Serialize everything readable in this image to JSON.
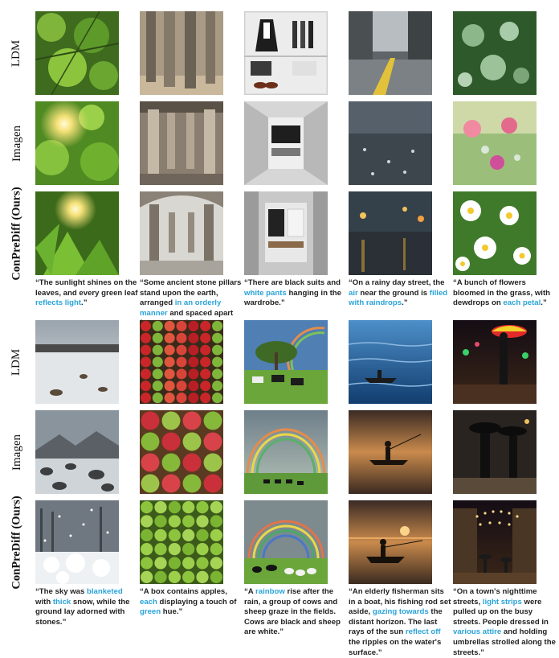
{
  "panels": [
    {
      "row_labels": [
        "LDM",
        "Imagen",
        "ConPreDiff (Ours)"
      ],
      "captions": [
        [
          {
            "t": "“The sunlight shines on the leaves, and every green leaf "
          },
          {
            "t": "reflects light",
            "h": true
          },
          {
            "t": ".”"
          }
        ],
        [
          {
            "t": "“Some ancient stone pillars stand upon the earth, arranged "
          },
          {
            "t": "in an orderly manner",
            "h": true
          },
          {
            "t": " and spaced apart from each other.”"
          }
        ],
        [
          {
            "t": "“There are black suits and "
          },
          {
            "t": "white pants",
            "h": true
          },
          {
            "t": " hanging in the wardrobe.”"
          }
        ],
        [
          {
            "t": "“On a rainy day street, the "
          },
          {
            "t": "air",
            "h": true
          },
          {
            "t": " near the ground is "
          },
          {
            "t": "filled with raindrops",
            "h": true
          },
          {
            "t": ".”"
          }
        ],
        [
          {
            "t": "“A bunch of flowers bloomed in the grass, with dewdrops on "
          },
          {
            "t": "each petal",
            "h": true
          },
          {
            "t": ".”"
          }
        ]
      ]
    },
    {
      "row_labels": [
        "LDM",
        "Imagen",
        "ConPreDiff (Ours)"
      ],
      "captions": [
        [
          {
            "t": "“The sky was "
          },
          {
            "t": "blanketed",
            "h": true
          },
          {
            "t": " with "
          },
          {
            "t": "thick",
            "h": true
          },
          {
            "t": " snow, while the ground lay adorned with stones.”"
          }
        ],
        [
          {
            "t": "“A box contains apples, "
          },
          {
            "t": "each",
            "h": true
          },
          {
            "t": " displaying a touch of "
          },
          {
            "t": "green",
            "h": true
          },
          {
            "t": " hue.”"
          }
        ],
        [
          {
            "t": "“A "
          },
          {
            "t": "rainbow",
            "h": true
          },
          {
            "t": " rise after the rain, a group of cows and sheep graze in the fields. Cows are black and sheep are white.”"
          }
        ],
        [
          {
            "t": "“An elderly fisherman sits in a boat, his fishing rod set aside, "
          },
          {
            "t": "gazing towards",
            "h": true
          },
          {
            "t": " the distant horizon. The last rays of the sun "
          },
          {
            "t": "reflect off",
            "h": true
          },
          {
            "t": " the ripples on the water's surface.”"
          }
        ],
        [
          {
            "t": "“On a town's nighttime streets, "
          },
          {
            "t": "light strips",
            "h": true
          },
          {
            "t": " were pulled up on the busy streets. People dressed in "
          },
          {
            "t": "various attire",
            "h": true
          },
          {
            "t": " and holding umbrellas strolled along the streets.”"
          }
        ]
      ]
    }
  ],
  "colors": {
    "highlight": "#2aa3d8",
    "text": "#222222"
  }
}
